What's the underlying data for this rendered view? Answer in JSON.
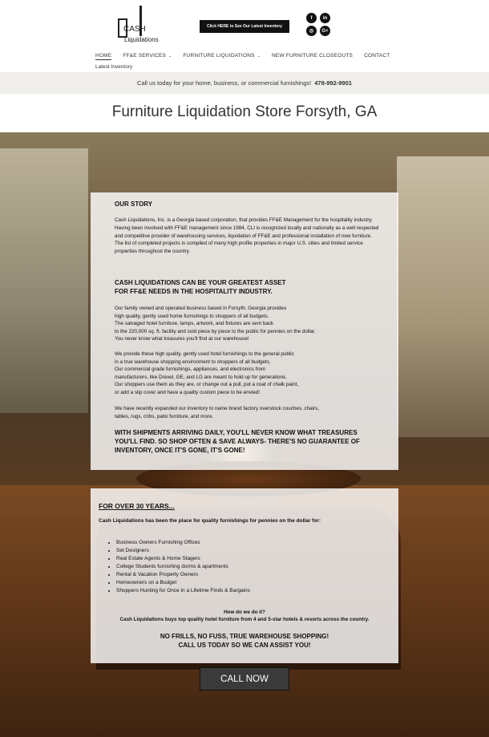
{
  "header": {
    "logo_text": "Liquidations",
    "logo_word": "CASH",
    "cta_label": "Click HERE to See Our Latest Inventory",
    "social": [
      "f",
      "in",
      "◎",
      "G+"
    ]
  },
  "nav": {
    "items": [
      {
        "label": "HOME",
        "active": true
      },
      {
        "label": "FF&E SERVICES",
        "caret": "⌄"
      },
      {
        "label": "FURNITURE LIQUIDATIONS",
        "caret": "⌄"
      },
      {
        "label": "NEW FURNITURE CLOSEOUTS"
      },
      {
        "label": "CONTACT"
      }
    ],
    "second_row": "Latest Inventory"
  },
  "phone_bar": {
    "text": "Call us today for your home, business, or commercial furnishings!",
    "number": "478-992-9901"
  },
  "page_title": "Furniture Liquidation Store Forsyth, GA",
  "story": {
    "heading": "OUR STORY",
    "paragraph": "Cash Liquidations, Inc. is a Georgia based corporation, that provides FF&E Management for the hospitality industry. Having been involved with FF&E management since 1984, CLI is recognized locally and nationally as a well respected and competitive provider of warehousing services, liquidation of FF&E and professional installation of new furniture. The list of completed projects is compiled of many high profile properties in major U.S. cities and limited service properties throughout the country.",
    "big_heading": "CASH LIQUIDATIONS CAN BE YOUR GREATEST ASSET\n FOR FF&E NEEDS IN THE HOSPITALITY INDUSTRY.",
    "block1": "Our family owned and operated business based in Forsyth, Georgia provides\nhigh quality, gently used home furnishings to shoppers of all budgets.\n The salvaged hotel furniture, lamps, artwork, and fixtures are sent back\nto the 220,000 sq. ft. facility and sold piece by piece to the public for pennies on the dollar.\n You never know what treasures you'll find at our warehouse!",
    "block2": "We provide these high quality, gently used hotel furnishings to the general public\nin a true warehouse shopping environment to shoppers of all budgets.\n Our commercial grade furnishings, appliances, and electronics from\nmanufacturers, like Drexel, GE, and LG are meant to hold up for generations.\nOur shoppers use them as they are, or change out a pull, put a coat of chalk paint,\n or add a slip cover and have a quality custom piece to be envied!",
    "block3": " We have recently expanded our inventory to name brand factory overstock couches, chairs,\n tables, rugs, cribs, patio furniture, and more.",
    "shipments": "WITH SHIPMENTS ARRIVING DAILY, YOU'LL NEVER KNOW WHAT TREASURES YOU'LL FIND.  SO SHOP OFTEN & SAVE ALWAYS- THERE'S NO GUARANTEE OF INVENTORY, ONCE IT'S GONE, IT'S GONE!"
  },
  "over30": {
    "heading": "FOR OVER 30 YEARS...",
    "intro": "Cash Liquidations has been the place for quality furnishings for pennies on the dollar for:",
    "bullets": [
      "Business Owners Furnishing Offices",
      "Set Designers",
      "Real Estate Agents & Home Stagers",
      "College Students furnishing dorms & apartments",
      " Rental & Vacation Property Owners",
      "Homeowners on a Budget",
      "Shoppers Hunting for Once in a Lifetime Finds & Bargains"
    ],
    "how_q": "How do we do it?",
    "how_a": "Cash Liquidations buys top quality hotel furniture from 4 and 5-star hotels & resorts across the country.",
    "final": "NO FRILLS, NO FUSS, TRUE WAREHOUSE SHOPPING!\nCALL US TODAY SO WE CAN ASSIST YOU!"
  },
  "call_button": "CALL NOW"
}
